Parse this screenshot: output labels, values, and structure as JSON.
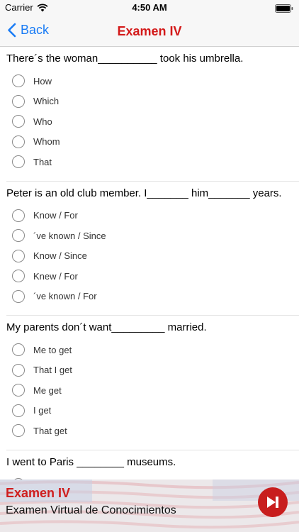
{
  "status_bar": {
    "carrier": "Carrier",
    "time": "4:50 AM"
  },
  "nav": {
    "back_label": "Back",
    "title": "Examen IV"
  },
  "questions": [
    {
      "text": "There´s the woman__________ took his umbrella.",
      "options": [
        "How",
        "Which",
        "Who",
        "Whom",
        "That"
      ]
    },
    {
      "text": "Peter is an old club member. I_______ him_______ years.",
      "options": [
        "Know / For",
        "´ve known / Since",
        "Know / Since",
        "Knew / For",
        "´ve known / For"
      ]
    },
    {
      "text": "My parents don´t want_________ married.",
      "options": [
        "Me to get",
        "That I get",
        "Me get",
        "I get",
        "That get"
      ]
    },
    {
      "text": "I went to Paris ________ museums.",
      "options": []
    }
  ],
  "footer": {
    "title": "Examen IV",
    "subtitle": "Examen Virtual de Conocimientos"
  },
  "colors": {
    "accent_red": "#d31919",
    "link_blue": "#1a7cf5"
  }
}
